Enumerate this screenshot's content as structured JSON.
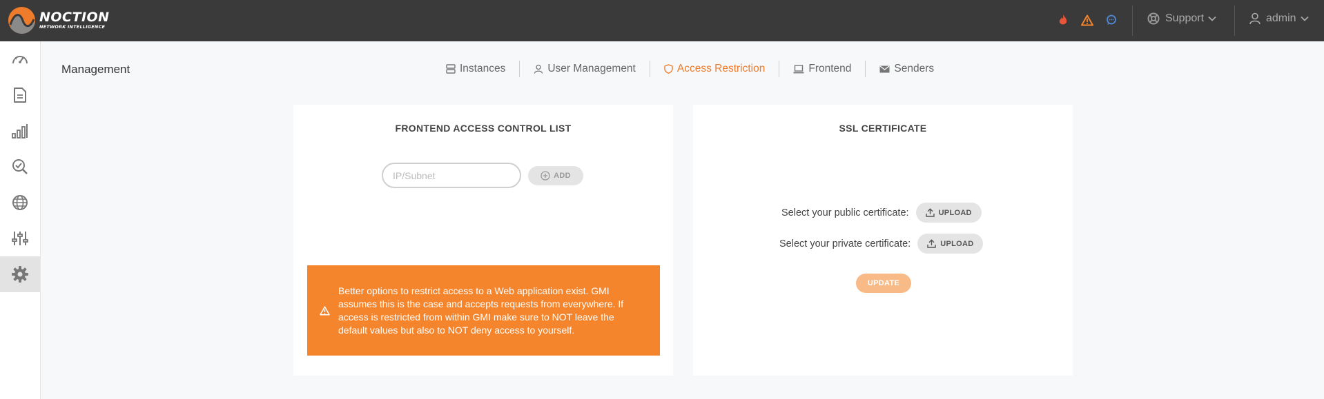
{
  "brand": {
    "name": "NOCTION",
    "tagline": "NETWORK INTELLIGENCE",
    "accent": "#ee7c2a"
  },
  "topbar": {
    "alerts": [
      {
        "icon": "flame-icon",
        "color": "#e8553a"
      },
      {
        "icon": "warning-triangle-icon",
        "color": "#f5852c"
      },
      {
        "icon": "chat-bubble-icon",
        "color": "#4f8ad8"
      }
    ],
    "support_label": "Support",
    "user_label": "admin"
  },
  "sidebar": {
    "items": [
      {
        "icon": "dashboard-gauge-icon",
        "active": false
      },
      {
        "icon": "document-icon",
        "active": false
      },
      {
        "icon": "bar-chart-icon",
        "active": false
      },
      {
        "icon": "search-check-icon",
        "active": false
      },
      {
        "icon": "globe-icon",
        "active": false
      },
      {
        "icon": "sliders-icon",
        "active": false
      },
      {
        "icon": "gear-icon",
        "active": true
      }
    ]
  },
  "page": {
    "title": "Management"
  },
  "tabs": [
    {
      "label": "Instances",
      "icon": "server-icon",
      "active": false
    },
    {
      "label": "User Management",
      "icon": "user-icon",
      "active": false
    },
    {
      "label": "Access Restriction",
      "icon": "shield-icon",
      "active": true
    },
    {
      "label": "Frontend",
      "icon": "laptop-icon",
      "active": false
    },
    {
      "label": "Senders",
      "icon": "envelope-icon",
      "active": false
    }
  ],
  "acl": {
    "title": "FRONTEND ACCESS CONTROL LIST",
    "input_placeholder": "IP/Subnet",
    "input_value": "",
    "add_label": "ADD",
    "warning_text": "Better options to restrict access to a Web application exist. GMI assumes this is the case and accepts requests from everywhere. If access is restricted from within GMI make sure to NOT leave the default values but also to NOT deny access to yourself."
  },
  "ssl": {
    "title": "SSL CERTIFICATE",
    "public_label": "Select your public certificate:",
    "private_label": "Select your private certificate:",
    "upload_label": "UPLOAD",
    "update_label": "UPDATE"
  }
}
